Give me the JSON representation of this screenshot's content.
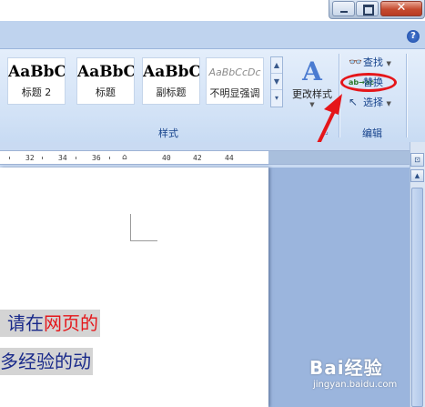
{
  "window": {
    "close_glyph": "✕"
  },
  "help_icon": "?",
  "styles_gallery": {
    "items": [
      {
        "sample": "AaBbC",
        "name": "标题 2"
      },
      {
        "sample": "AaBbC",
        "name": "标题"
      },
      {
        "sample": "AaBbC",
        "name": "副标题"
      },
      {
        "sample": "AaBbCcDc",
        "name": "不明显强调"
      }
    ],
    "change_styles_label": "更改样式",
    "group_label": "样式"
  },
  "editing": {
    "find_label": "查找",
    "replace_label": "替换",
    "select_label": "选择",
    "group_label": "编辑"
  },
  "ruler": {
    "labels": [
      "32",
      "34",
      "36",
      "40",
      "42",
      "44"
    ]
  },
  "document": {
    "line1_prefix": "请在",
    "line1_highlight": "网页的",
    "line2": "多经验的动"
  },
  "watermark": {
    "brand": "Bai经验",
    "url": "jingyan.baidu.com"
  },
  "colors": {
    "annotation": "#e5161a",
    "ribbon": "#d2e2f6",
    "doc_text": "#1a2a8a"
  }
}
